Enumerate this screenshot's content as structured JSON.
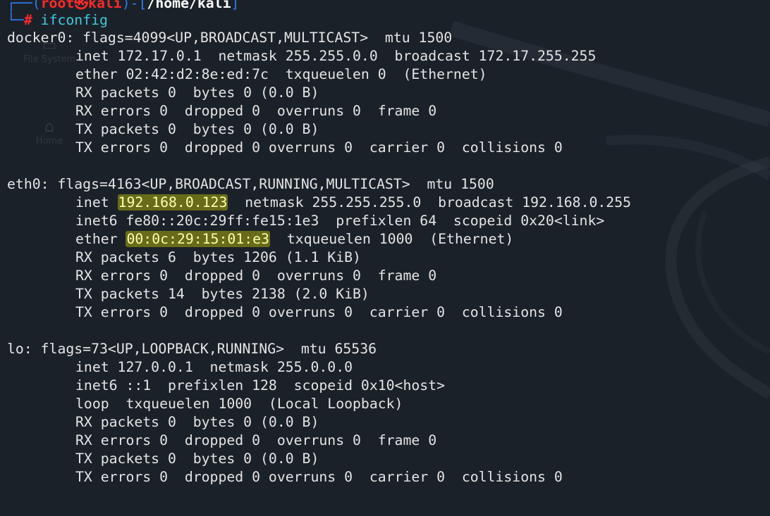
{
  "prompt": {
    "open_bracket": "┌──(",
    "user": "root㉿kali",
    "sep": ")-[",
    "cwd": "/home/kali",
    "close": "]",
    "cmd_prefix": "└─",
    "symbol": "#",
    "command": "ifconfig"
  },
  "desktop_icons": [
    {
      "icon": "drive-icon",
      "label": "File System"
    },
    {
      "icon": "home-icon",
      "label": "Home"
    }
  ],
  "interfaces": {
    "docker0": {
      "header": "docker0: flags=4099<UP,BROADCAST,MULTICAST>  mtu 1500",
      "inet": "inet 172.17.0.1  netmask 255.255.0.0  broadcast 172.17.255.255",
      "ether": "ether 02:42:d2:8e:ed:7c  txqueuelen 0  (Ethernet)",
      "rx_packets": "RX packets 0  bytes 0 (0.0 B)",
      "rx_errors": "RX errors 0  dropped 0  overruns 0  frame 0",
      "tx_packets": "TX packets 0  bytes 0 (0.0 B)",
      "tx_errors": "TX errors 0  dropped 0 overruns 0  carrier 0  collisions 0"
    },
    "eth0": {
      "header": "eth0: flags=4163<UP,BROADCAST,RUNNING,MULTICAST>  mtu 1500",
      "inet_prefix": "inet ",
      "inet_addr": "192.168.0.123",
      "inet_suffix": "  netmask 255.255.255.0  broadcast 192.168.0.255",
      "inet6": "inet6 fe80::20c:29ff:fe15:1e3  prefixlen 64  scopeid 0x20<link>",
      "ether_prefix": "ether ",
      "ether_addr": "00:0c:29:15:01:e3",
      "ether_suffix": "  txqueuelen 1000  (Ethernet)",
      "rx_packets": "RX packets 6  bytes 1206 (1.1 KiB)",
      "rx_errors": "RX errors 0  dropped 0  overruns 0  frame 0",
      "tx_packets": "TX packets 14  bytes 2138 (2.0 KiB)",
      "tx_errors": "TX errors 0  dropped 0 overruns 0  carrier 0  collisions 0"
    },
    "lo": {
      "header": "lo: flags=73<UP,LOOPBACK,RUNNING>  mtu 65536",
      "inet": "inet 127.0.0.1  netmask 255.0.0.0",
      "inet6": "inet6 ::1  prefixlen 128  scopeid 0x10<host>",
      "loop": "loop  txqueuelen 1000  (Local Loopback)",
      "rx_packets": "RX packets 0  bytes 0 (0.0 B)",
      "rx_errors": "RX errors 0  dropped 0  overruns 0  frame 0",
      "tx_packets": "TX packets 0  bytes 0 (0.0 B)",
      "tx_errors": "TX errors 0  dropped 0 overruns 0  carrier 0  collisions 0"
    }
  },
  "colors": {
    "background": "#1b2129",
    "text": "#e4e4e4",
    "prompt_bracket": "#2f7bf0",
    "prompt_user": "#ff2a2a",
    "command": "#3fc8d9",
    "highlight": "#e8e800"
  }
}
